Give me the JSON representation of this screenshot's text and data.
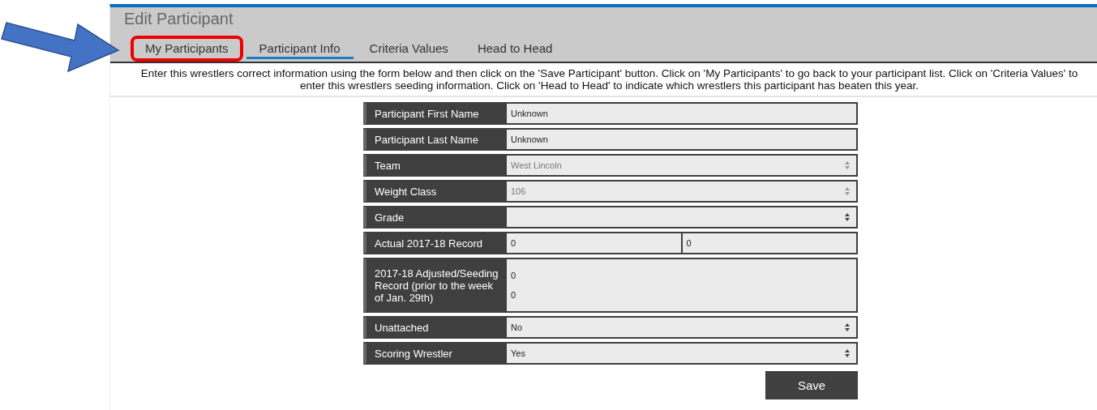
{
  "page": {
    "title": "Edit Participant"
  },
  "tabs": [
    {
      "label": "My Participants",
      "selected": false,
      "highlighted": true
    },
    {
      "label": "Participant Info",
      "selected": true,
      "highlighted": false
    },
    {
      "label": "Criteria Values",
      "selected": false,
      "highlighted": false
    },
    {
      "label": "Head to Head",
      "selected": false,
      "highlighted": false
    }
  ],
  "instructions": "Enter this wrestlers correct information using the form below and then click on the 'Save Participant' button. Click on 'My Participants' to go back to your participant list. Click on 'Criteria Values' to enter this wrestlers seeding information. Click on 'Head to Head' to indicate which wrestlers this participant has beaten this year.",
  "form": [
    {
      "kind": "text",
      "label": "Participant First Name",
      "values": [
        "Unknown"
      ]
    },
    {
      "kind": "text",
      "label": "Participant Last Name",
      "values": [
        "Unknown"
      ]
    },
    {
      "kind": "select",
      "label": "Team",
      "values": [
        "West Lincoln"
      ],
      "disabled": true
    },
    {
      "kind": "select",
      "label": "Weight Class",
      "values": [
        "106"
      ],
      "disabled": true
    },
    {
      "kind": "select",
      "label": "Grade",
      "disabled": false
    },
    {
      "kind": "pair",
      "label": "Actual 2017-18 Record",
      "values": [
        "0",
        "0"
      ]
    },
    {
      "kind": "stack",
      "label": "2017-18 Adjusted/Seeding Record (prior to the week of Jan. 29th)",
      "values": [
        "0",
        "0"
      ]
    },
    {
      "kind": "select",
      "label": "Unattached",
      "values": [
        "No"
      ],
      "disabled": false
    },
    {
      "kind": "select",
      "label": "Scoring Wrestler",
      "values": [
        "Yes"
      ],
      "disabled": false
    }
  ],
  "save_button": "Save"
}
